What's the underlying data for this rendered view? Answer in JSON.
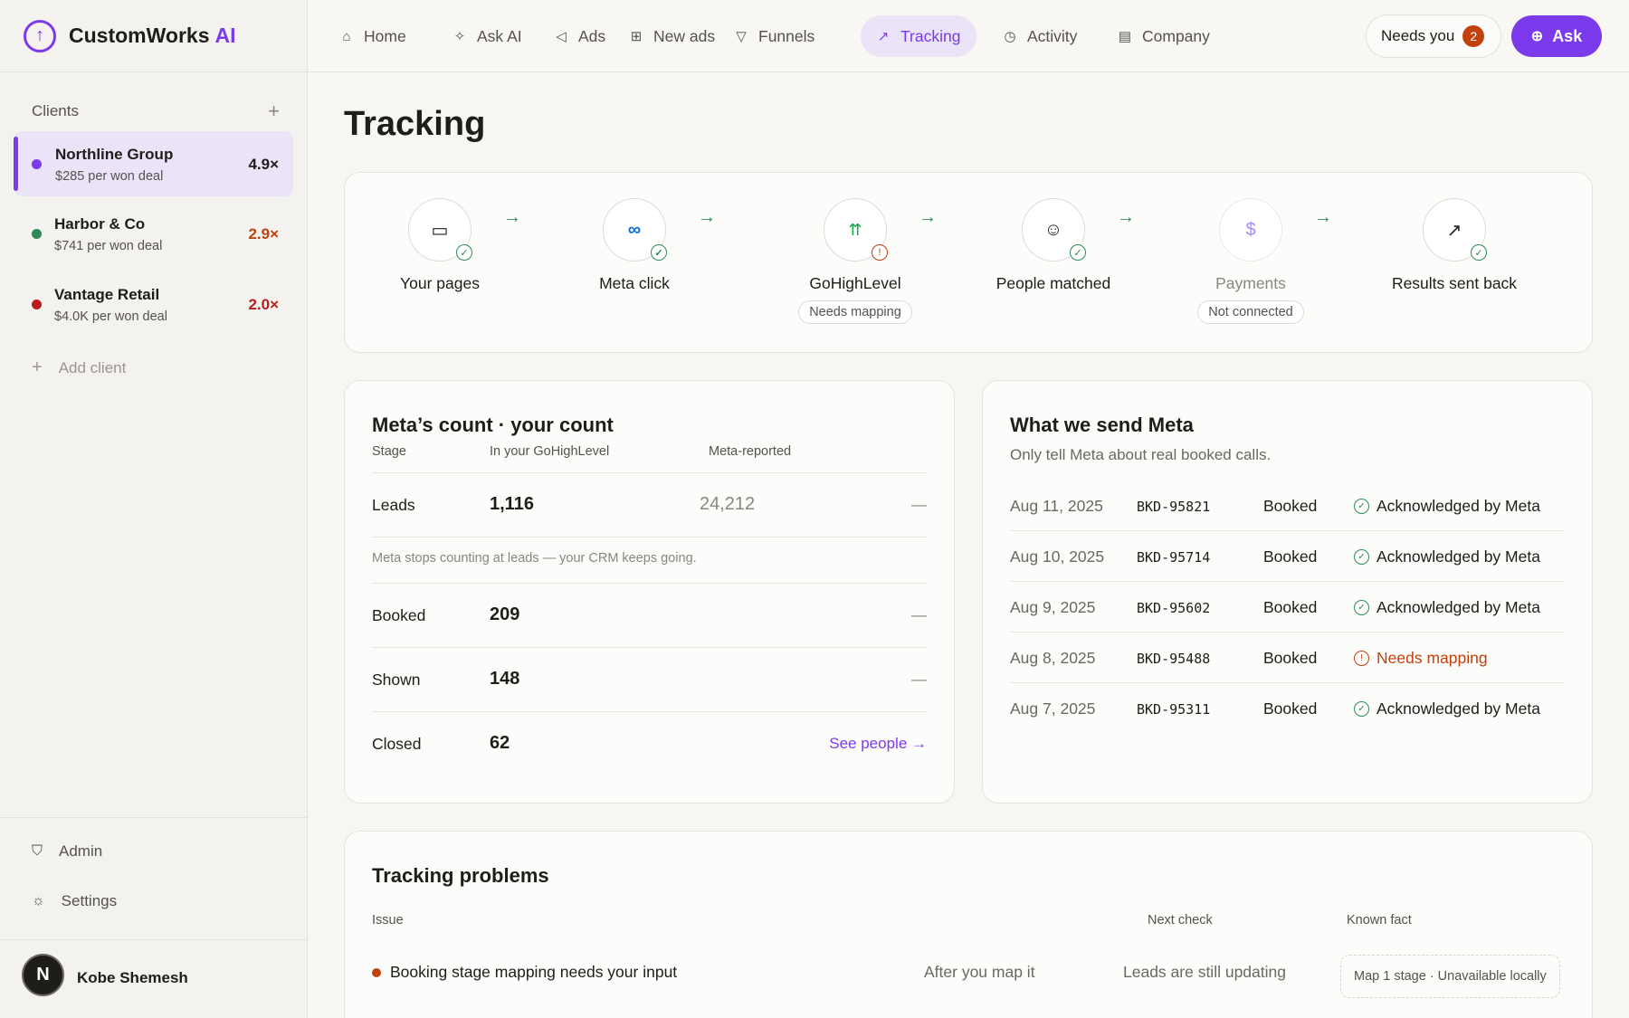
{
  "brand": {
    "name": "CustomWorks",
    "suffix": "AI"
  },
  "nav": {
    "items": [
      {
        "label": "Home",
        "icon": "home-icon"
      },
      {
        "label": "Ask AI",
        "icon": "sparkle-icon"
      },
      {
        "label": "Ads",
        "icon": "megaphone-icon"
      },
      {
        "label": "New ads",
        "icon": "plus-square-icon"
      },
      {
        "label": "Funnels",
        "icon": "funnel-icon"
      },
      {
        "label": "Tracking",
        "icon": "trend-icon",
        "active": true
      },
      {
        "label": "Activity",
        "icon": "clock-icon"
      },
      {
        "label": "Company",
        "icon": "building-icon"
      }
    ],
    "needs_you": "Needs you",
    "needs_count": "2",
    "ask": "Ask"
  },
  "sidebar": {
    "clients_label": "Clients",
    "clients": [
      {
        "name": "Northline Group",
        "sub": "$285 per won deal",
        "mult": "4.9×",
        "dot": "#7c3aed",
        "mult_color": "#1f1d1a"
      },
      {
        "name": "Harbor & Co",
        "sub": "$741 per won deal",
        "mult": "2.9×",
        "dot": "#2e8b57",
        "mult_color": "#c2410c"
      },
      {
        "name": "Vantage Retail",
        "sub": "$4.0K per won deal",
        "mult": "2.0×",
        "dot": "#b91c1c",
        "mult_color": "#b91c1c"
      }
    ],
    "add_client": "Add client",
    "admin": "Admin",
    "settings": "Settings",
    "user_initial": "N",
    "user_name": "Kobe Shemesh"
  },
  "page": {
    "title": "Tracking"
  },
  "pipeline": [
    {
      "label": "Your pages",
      "status": "ok",
      "pill": ""
    },
    {
      "label": "Meta click",
      "status": "ok",
      "pill": ""
    },
    {
      "label": "GoHighLevel",
      "status": "warn",
      "pill": "Needs mapping"
    },
    {
      "label": "People matched",
      "status": "ok",
      "pill": ""
    },
    {
      "label": "Payments",
      "status": "none",
      "pill": "Not connected"
    },
    {
      "label": "Results sent back",
      "status": "ok",
      "pill": ""
    }
  ],
  "counts": {
    "title": "Meta’s count · your count",
    "col_stage": "Stage",
    "col_crm": "In your GoHighLevel",
    "col_meta": "Meta-reported",
    "note": "Meta stops counting at leads — your CRM keeps going.",
    "rows": [
      {
        "stage": "Leads",
        "crm": "1,116",
        "meta": "24,212",
        "trail": "—"
      },
      {
        "stage": "Booked",
        "crm": "209",
        "trail": "—"
      },
      {
        "stage": "Shown",
        "crm": "148",
        "trail": "—"
      },
      {
        "stage": "Closed",
        "crm": "62",
        "link": "See people →"
      }
    ]
  },
  "send": {
    "title": "What we send Meta",
    "subtitle": "Only tell Meta about real booked calls.",
    "rows": [
      {
        "date": "Aug 11, 2025",
        "id": "BKD-95821",
        "stage": "Booked",
        "status": "Acknowledged by Meta",
        "warn": false
      },
      {
        "date": "Aug 10, 2025",
        "id": "BKD-95714",
        "stage": "Booked",
        "status": "Acknowledged by Meta",
        "warn": false
      },
      {
        "date": "Aug 9, 2025",
        "id": "BKD-95602",
        "stage": "Booked",
        "status": "Acknowledged by Meta",
        "warn": false
      },
      {
        "date": "Aug 8, 2025",
        "id": "BKD-95488",
        "stage": "Booked",
        "status": "Needs mapping",
        "warn": true
      },
      {
        "date": "Aug 7, 2025",
        "id": "BKD-95311",
        "stage": "Booked",
        "status": "Acknowledged by Meta",
        "warn": false
      }
    ]
  },
  "problems": {
    "title": "Tracking problems",
    "col_issue": "Issue",
    "col_next": "Next check",
    "col_fact": "Known fact",
    "row": {
      "issue": "Booking stage mapping needs your input",
      "when": "After you map it",
      "next": "Leads are still updating",
      "fact": "Map 1 stage · Unavailable locally"
    }
  }
}
